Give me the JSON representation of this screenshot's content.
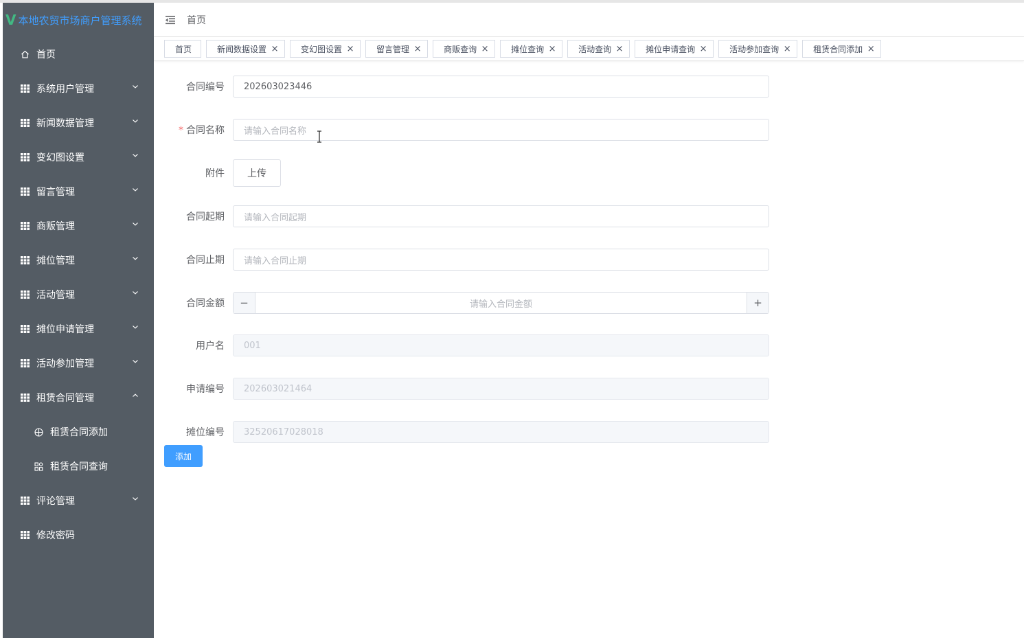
{
  "app": {
    "logo_letter": "V",
    "title": "本地农贸市场商户管理系统"
  },
  "sidebar": {
    "items": [
      {
        "label": "首页",
        "icon": "home-icon"
      },
      {
        "label": "系统用户管理",
        "icon": "grid-icon"
      },
      {
        "label": "新闻数据管理",
        "icon": "grid-icon"
      },
      {
        "label": "变幻图设置",
        "icon": "grid-icon"
      },
      {
        "label": "留言管理",
        "icon": "grid-icon"
      },
      {
        "label": "商贩管理",
        "icon": "grid-icon"
      },
      {
        "label": "摊位管理",
        "icon": "grid-icon"
      },
      {
        "label": "活动管理",
        "icon": "grid-icon"
      },
      {
        "label": "摊位申请管理",
        "icon": "grid-icon"
      },
      {
        "label": "活动参加管理",
        "icon": "grid-icon"
      },
      {
        "label": "租赁合同管理",
        "icon": "grid-icon"
      },
      {
        "label": "租赁合同添加",
        "icon": "circle-plus-icon"
      },
      {
        "label": "租赁合同查询",
        "icon": "apps-icon"
      },
      {
        "label": "评论管理",
        "icon": "grid-icon"
      },
      {
        "label": "修改密码",
        "icon": "grid-icon"
      }
    ]
  },
  "header": {
    "breadcrumb": "首页"
  },
  "tabs": [
    {
      "label": "首页"
    },
    {
      "label": "新闻数据设置"
    },
    {
      "label": "变幻图设置"
    },
    {
      "label": "留言管理"
    },
    {
      "label": "商贩查询"
    },
    {
      "label": "摊位查询"
    },
    {
      "label": "活动查询"
    },
    {
      "label": "摊位申请查询"
    },
    {
      "label": "活动参加查询"
    },
    {
      "label": "租赁合同添加"
    }
  ],
  "tab_close_glyph": "×",
  "form": {
    "contract_no": {
      "label": "合同编号",
      "value": "202603023446"
    },
    "contract_name": {
      "required_mark": "*",
      "label": "合同名称",
      "placeholder": "请输入合同名称"
    },
    "attachment": {
      "label": "附件",
      "button": "上传"
    },
    "start_date": {
      "label": "合同起期",
      "placeholder": "请输入合同起期"
    },
    "end_date": {
      "label": "合同止期",
      "placeholder": "请输入合同止期"
    },
    "amount": {
      "label": "合同金额",
      "placeholder": "请输入合同金额",
      "minus": "−",
      "plus": "+"
    },
    "username": {
      "label": "用户名",
      "value": "001"
    },
    "application_no": {
      "label": "申请编号",
      "value": "202603021464"
    },
    "stall_no": {
      "label": "摊位编号",
      "value": "32520617028018"
    },
    "submit": "添加"
  },
  "colors": {
    "sidebar_bg": "#545c64",
    "primary": "#409eff",
    "logo_green": "#42b983"
  }
}
